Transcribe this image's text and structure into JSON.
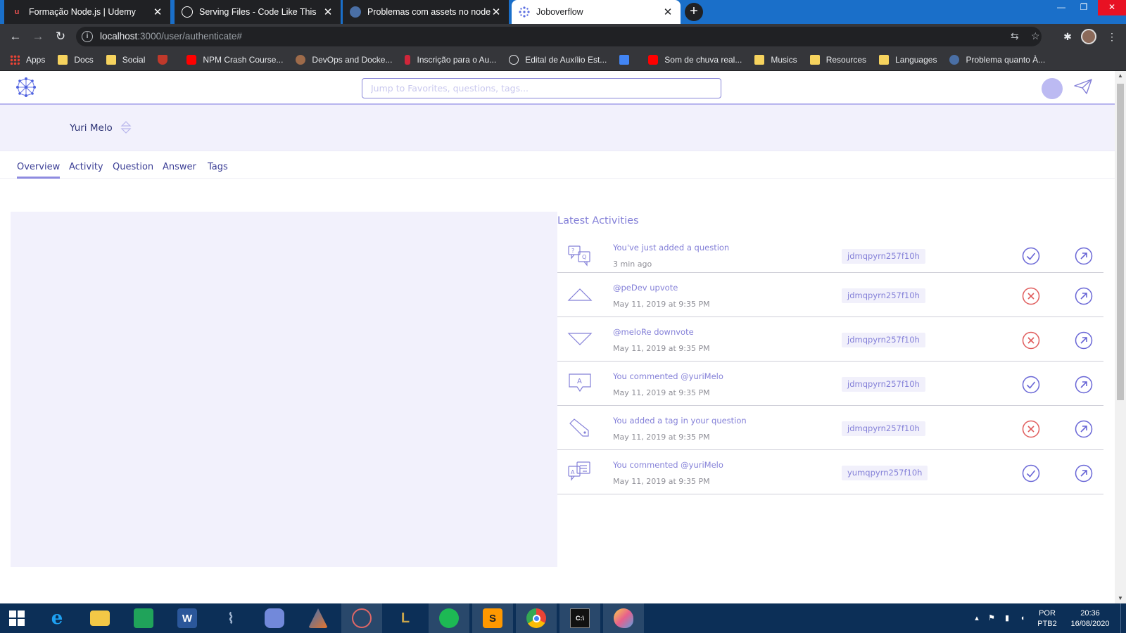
{
  "browser": {
    "tabs": [
      {
        "title": "Formação Node.js | Udemy",
        "icon": "udemy-icon",
        "color": "#ec5252"
      },
      {
        "title": "Serving Files - Code Like This",
        "icon": "page-icon",
        "color": "#ffffff"
      },
      {
        "title": "Problemas com assets no nodeJS",
        "icon": "forum-icon",
        "color": "#4a6fa5"
      },
      {
        "title": "Joboverflow",
        "icon": "joboverflow-icon",
        "color": "#7b78e0"
      }
    ],
    "url_host": "localhost",
    "url_path": ":3000/user/authenticate#",
    "bookmarks": [
      {
        "label": "Apps",
        "icon": "apps-grid-icon"
      },
      {
        "label": "Docs",
        "icon": "folder-icon"
      },
      {
        "label": "Social",
        "icon": "folder-icon"
      },
      {
        "label": "",
        "icon": "shield-icon"
      },
      {
        "label": "NPM Crash Course...",
        "icon": "youtube-icon"
      },
      {
        "label": "DevOps and Docke...",
        "icon": "udemy-icon"
      },
      {
        "label": "Inscrição para o Au...",
        "icon": "bookmark-icon"
      },
      {
        "label": "Edital de Auxílio Est...",
        "icon": "globe-icon"
      },
      {
        "label": "",
        "icon": "translate-icon"
      },
      {
        "label": "Som de chuva real...",
        "icon": "youtube-icon"
      },
      {
        "label": "Musics",
        "icon": "folder-icon"
      },
      {
        "label": "Resources",
        "icon": "folder-icon"
      },
      {
        "label": "Languages",
        "icon": "folder-icon"
      },
      {
        "label": "Problema quanto À...",
        "icon": "forum-icon"
      }
    ]
  },
  "app": {
    "search_placeholder": "Jump to Favorites, questions, tags...",
    "user_name": "Yuri Melo",
    "nav_tabs": [
      "Overview",
      "Activity",
      "Question",
      "Answer",
      "Tags"
    ],
    "active_tab": "Overview",
    "activities_title": "Latest Activities",
    "activities": [
      {
        "title": "You've just added a question",
        "time": "3 min ago",
        "tag": "jdmqpyrn257f10h",
        "status": "success",
        "icon": "question-chat-icon"
      },
      {
        "title": "@peDev upvote",
        "time": "May 11, 2019 at 9:35 PM",
        "tag": "jdmqpyrn257f10h",
        "status": "error",
        "icon": "upvote-icon"
      },
      {
        "title": "@meloRe downvote",
        "time": "May 11, 2019 at 9:35 PM",
        "tag": "jdmqpyrn257f10h",
        "status": "error",
        "icon": "downvote-icon"
      },
      {
        "title": "You commented @yuriMelo",
        "time": "May 11, 2019 at 9:35 PM",
        "tag": "jdmqpyrn257f10h",
        "status": "success",
        "icon": "answer-bubble-icon"
      },
      {
        "title": "You added a tag in your question",
        "time": "May 11, 2019 at 9:35 PM",
        "tag": "jdmqpyrn257f10h",
        "status": "error",
        "icon": "tag-icon"
      },
      {
        "title": "You commented @yuriMelo",
        "time": "May 11, 2019 at 9:35 PM",
        "tag": "yumqpyrn257f10h",
        "status": "success",
        "icon": "comment-chat-icon"
      }
    ],
    "colors": {
      "accent": "#8480d8",
      "success": "#6966d6",
      "error": "#e05c5c",
      "panel": "#f2f1fc"
    }
  },
  "taskbar": {
    "apps": [
      "start-icon",
      "internet-explorer-icon",
      "file-explorer-icon",
      "store-icon",
      "word-icon",
      "mysql-workbench-icon",
      "discord-icon",
      "matlab-icon",
      "paint-icon",
      "league-of-legends-icon",
      "spotify-icon",
      "sublime-text-icon",
      "chrome-icon",
      "terminal-icon",
      "paint-3d-icon"
    ],
    "language": "POR",
    "layout": "PTB2",
    "time": "20:36",
    "date": "16/08/2020"
  }
}
